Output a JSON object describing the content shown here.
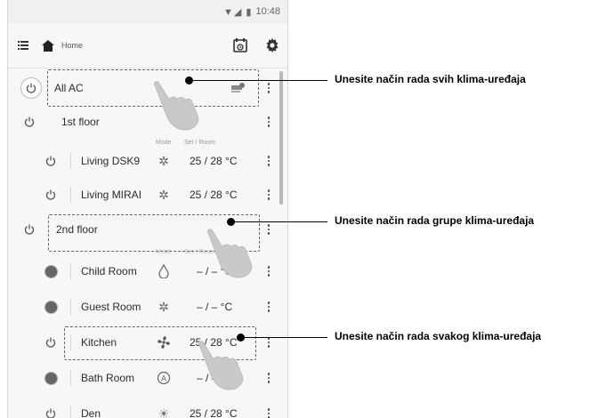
{
  "statusbar": {
    "time": "10:48",
    "signal_icons": "▼◢ ▮"
  },
  "toolbar": {
    "title": "Home"
  },
  "columns": {
    "mode": "Mode",
    "set_room": "Set / Room"
  },
  "rows": [
    {
      "name": "All AC",
      "power": "on",
      "mode_icon": "schedule-icon",
      "temp": ""
    },
    {
      "name": "1st floor",
      "power": "on",
      "mode_icon": "",
      "temp": ""
    },
    {
      "name": "Living DSK9",
      "power": "on",
      "mode_icon": "heat-icon",
      "temp": "25 / 28 °C"
    },
    {
      "name": "Living MIRAI",
      "power": "on",
      "mode_icon": "heat-icon",
      "temp": "25 / 28 °C"
    },
    {
      "name": "2nd floor",
      "power": "on",
      "mode_icon": "",
      "temp": ""
    },
    {
      "name": "Child Room",
      "power": "off",
      "mode_icon": "dry-icon",
      "temp": "– / –  °C"
    },
    {
      "name": "Guest Room",
      "power": "off",
      "mode_icon": "heat-icon",
      "temp": "– / –  °C"
    },
    {
      "name": "Kitchen",
      "power": "on",
      "mode_icon": "fan-icon",
      "temp": "25 / 28 °C"
    },
    {
      "name": "Bath Room",
      "power": "off",
      "mode_icon": "auto-icon",
      "temp": "– / –  °C"
    },
    {
      "name": "Den",
      "power": "on",
      "mode_icon": "cool-icon",
      "temp": "25 / 28 °C"
    }
  ],
  "callouts": {
    "all": "Unesite način rada svih klima-uređaja",
    "group": "Unesite način rada grupe klima-uređaja",
    "each": "Unesite način rada svakog klima-uređaja"
  }
}
